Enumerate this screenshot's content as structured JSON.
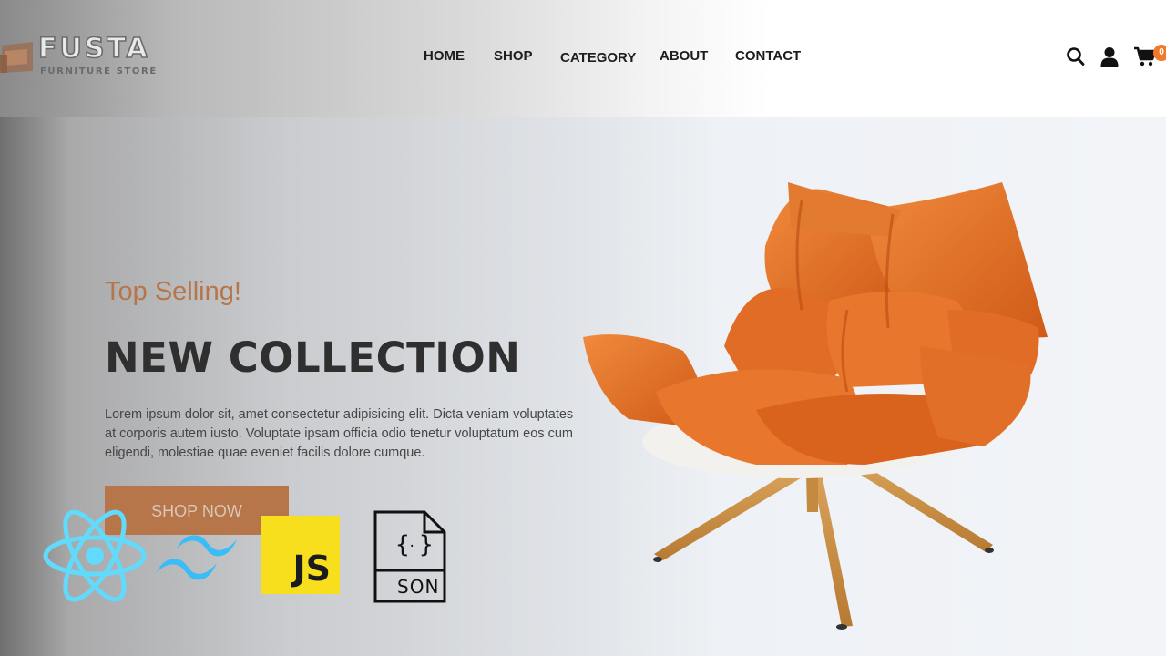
{
  "brand": {
    "name": "FUSTA",
    "tagline": "FURNITURE STORE"
  },
  "nav": {
    "items": [
      "HOME",
      "SHOP",
      "CATEGORY",
      "ABOUT",
      "CONTACT"
    ]
  },
  "header_icons": {
    "search": "search-icon",
    "account": "user-icon",
    "cart": "cart-icon",
    "cart_count": "0"
  },
  "hero": {
    "eyebrow": "Top Selling!",
    "title": "NEW COLLECTION",
    "description": "Lorem ipsum dolor sit, amet consectetur adipisicing elit. Dicta veniam voluptates at corporis autem iusto. Voluptate ipsam officia odio tenetur voluptatum eos cum eligendi, molestiae quae eveniet facilis dolore cumque.",
    "cta": "SHOP NOW"
  },
  "tech_logos": {
    "react": "react-logo",
    "tailwind": "tailwind-logo",
    "js": "JS",
    "json": "SON"
  },
  "colors": {
    "accent": "#b7754a",
    "badge": "#f07a2a",
    "chair": "#e2681f",
    "js_yellow": "#f7df1e",
    "react_blue": "#61dafb",
    "tailwind_blue": "#38bdf8"
  }
}
